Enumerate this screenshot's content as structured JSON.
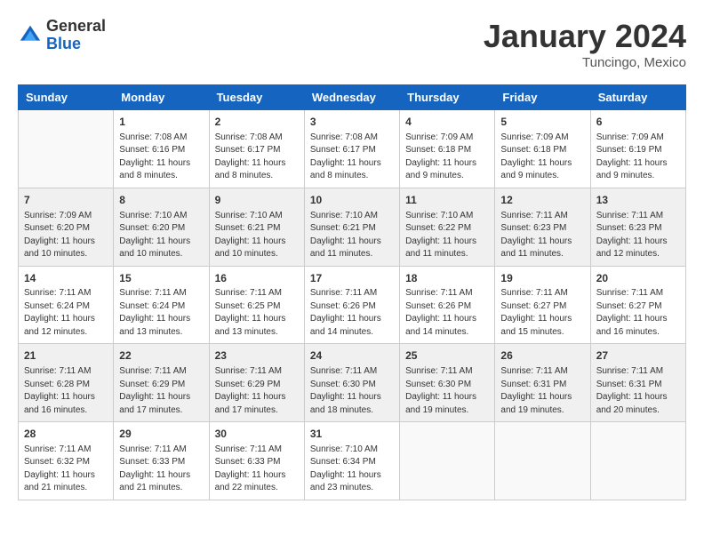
{
  "header": {
    "logo": {
      "general": "General",
      "blue": "Blue"
    },
    "title": "January 2024",
    "location": "Tuncingo, Mexico"
  },
  "days_of_week": [
    "Sunday",
    "Monday",
    "Tuesday",
    "Wednesday",
    "Thursday",
    "Friday",
    "Saturday"
  ],
  "weeks": [
    [
      {
        "day": "",
        "sunrise": "",
        "sunset": "",
        "daylight": ""
      },
      {
        "day": "1",
        "sunrise": "Sunrise: 7:08 AM",
        "sunset": "Sunset: 6:16 PM",
        "daylight": "Daylight: 11 hours and 8 minutes."
      },
      {
        "day": "2",
        "sunrise": "Sunrise: 7:08 AM",
        "sunset": "Sunset: 6:17 PM",
        "daylight": "Daylight: 11 hours and 8 minutes."
      },
      {
        "day": "3",
        "sunrise": "Sunrise: 7:08 AM",
        "sunset": "Sunset: 6:17 PM",
        "daylight": "Daylight: 11 hours and 8 minutes."
      },
      {
        "day": "4",
        "sunrise": "Sunrise: 7:09 AM",
        "sunset": "Sunset: 6:18 PM",
        "daylight": "Daylight: 11 hours and 9 minutes."
      },
      {
        "day": "5",
        "sunrise": "Sunrise: 7:09 AM",
        "sunset": "Sunset: 6:18 PM",
        "daylight": "Daylight: 11 hours and 9 minutes."
      },
      {
        "day": "6",
        "sunrise": "Sunrise: 7:09 AM",
        "sunset": "Sunset: 6:19 PM",
        "daylight": "Daylight: 11 hours and 9 minutes."
      }
    ],
    [
      {
        "day": "7",
        "sunrise": "Sunrise: 7:09 AM",
        "sunset": "Sunset: 6:20 PM",
        "daylight": "Daylight: 11 hours and 10 minutes."
      },
      {
        "day": "8",
        "sunrise": "Sunrise: 7:10 AM",
        "sunset": "Sunset: 6:20 PM",
        "daylight": "Daylight: 11 hours and 10 minutes."
      },
      {
        "day": "9",
        "sunrise": "Sunrise: 7:10 AM",
        "sunset": "Sunset: 6:21 PM",
        "daylight": "Daylight: 11 hours and 10 minutes."
      },
      {
        "day": "10",
        "sunrise": "Sunrise: 7:10 AM",
        "sunset": "Sunset: 6:21 PM",
        "daylight": "Daylight: 11 hours and 11 minutes."
      },
      {
        "day": "11",
        "sunrise": "Sunrise: 7:10 AM",
        "sunset": "Sunset: 6:22 PM",
        "daylight": "Daylight: 11 hours and 11 minutes."
      },
      {
        "day": "12",
        "sunrise": "Sunrise: 7:11 AM",
        "sunset": "Sunset: 6:23 PM",
        "daylight": "Daylight: 11 hours and 11 minutes."
      },
      {
        "day": "13",
        "sunrise": "Sunrise: 7:11 AM",
        "sunset": "Sunset: 6:23 PM",
        "daylight": "Daylight: 11 hours and 12 minutes."
      }
    ],
    [
      {
        "day": "14",
        "sunrise": "Sunrise: 7:11 AM",
        "sunset": "Sunset: 6:24 PM",
        "daylight": "Daylight: 11 hours and 12 minutes."
      },
      {
        "day": "15",
        "sunrise": "Sunrise: 7:11 AM",
        "sunset": "Sunset: 6:24 PM",
        "daylight": "Daylight: 11 hours and 13 minutes."
      },
      {
        "day": "16",
        "sunrise": "Sunrise: 7:11 AM",
        "sunset": "Sunset: 6:25 PM",
        "daylight": "Daylight: 11 hours and 13 minutes."
      },
      {
        "day": "17",
        "sunrise": "Sunrise: 7:11 AM",
        "sunset": "Sunset: 6:26 PM",
        "daylight": "Daylight: 11 hours and 14 minutes."
      },
      {
        "day": "18",
        "sunrise": "Sunrise: 7:11 AM",
        "sunset": "Sunset: 6:26 PM",
        "daylight": "Daylight: 11 hours and 14 minutes."
      },
      {
        "day": "19",
        "sunrise": "Sunrise: 7:11 AM",
        "sunset": "Sunset: 6:27 PM",
        "daylight": "Daylight: 11 hours and 15 minutes."
      },
      {
        "day": "20",
        "sunrise": "Sunrise: 7:11 AM",
        "sunset": "Sunset: 6:27 PM",
        "daylight": "Daylight: 11 hours and 16 minutes."
      }
    ],
    [
      {
        "day": "21",
        "sunrise": "Sunrise: 7:11 AM",
        "sunset": "Sunset: 6:28 PM",
        "daylight": "Daylight: 11 hours and 16 minutes."
      },
      {
        "day": "22",
        "sunrise": "Sunrise: 7:11 AM",
        "sunset": "Sunset: 6:29 PM",
        "daylight": "Daylight: 11 hours and 17 minutes."
      },
      {
        "day": "23",
        "sunrise": "Sunrise: 7:11 AM",
        "sunset": "Sunset: 6:29 PM",
        "daylight": "Daylight: 11 hours and 17 minutes."
      },
      {
        "day": "24",
        "sunrise": "Sunrise: 7:11 AM",
        "sunset": "Sunset: 6:30 PM",
        "daylight": "Daylight: 11 hours and 18 minutes."
      },
      {
        "day": "25",
        "sunrise": "Sunrise: 7:11 AM",
        "sunset": "Sunset: 6:30 PM",
        "daylight": "Daylight: 11 hours and 19 minutes."
      },
      {
        "day": "26",
        "sunrise": "Sunrise: 7:11 AM",
        "sunset": "Sunset: 6:31 PM",
        "daylight": "Daylight: 11 hours and 19 minutes."
      },
      {
        "day": "27",
        "sunrise": "Sunrise: 7:11 AM",
        "sunset": "Sunset: 6:31 PM",
        "daylight": "Daylight: 11 hours and 20 minutes."
      }
    ],
    [
      {
        "day": "28",
        "sunrise": "Sunrise: 7:11 AM",
        "sunset": "Sunset: 6:32 PM",
        "daylight": "Daylight: 11 hours and 21 minutes."
      },
      {
        "day": "29",
        "sunrise": "Sunrise: 7:11 AM",
        "sunset": "Sunset: 6:33 PM",
        "daylight": "Daylight: 11 hours and 21 minutes."
      },
      {
        "day": "30",
        "sunrise": "Sunrise: 7:11 AM",
        "sunset": "Sunset: 6:33 PM",
        "daylight": "Daylight: 11 hours and 22 minutes."
      },
      {
        "day": "31",
        "sunrise": "Sunrise: 7:10 AM",
        "sunset": "Sunset: 6:34 PM",
        "daylight": "Daylight: 11 hours and 23 minutes."
      },
      {
        "day": "",
        "sunrise": "",
        "sunset": "",
        "daylight": ""
      },
      {
        "day": "",
        "sunrise": "",
        "sunset": "",
        "daylight": ""
      },
      {
        "day": "",
        "sunrise": "",
        "sunset": "",
        "daylight": ""
      }
    ]
  ]
}
